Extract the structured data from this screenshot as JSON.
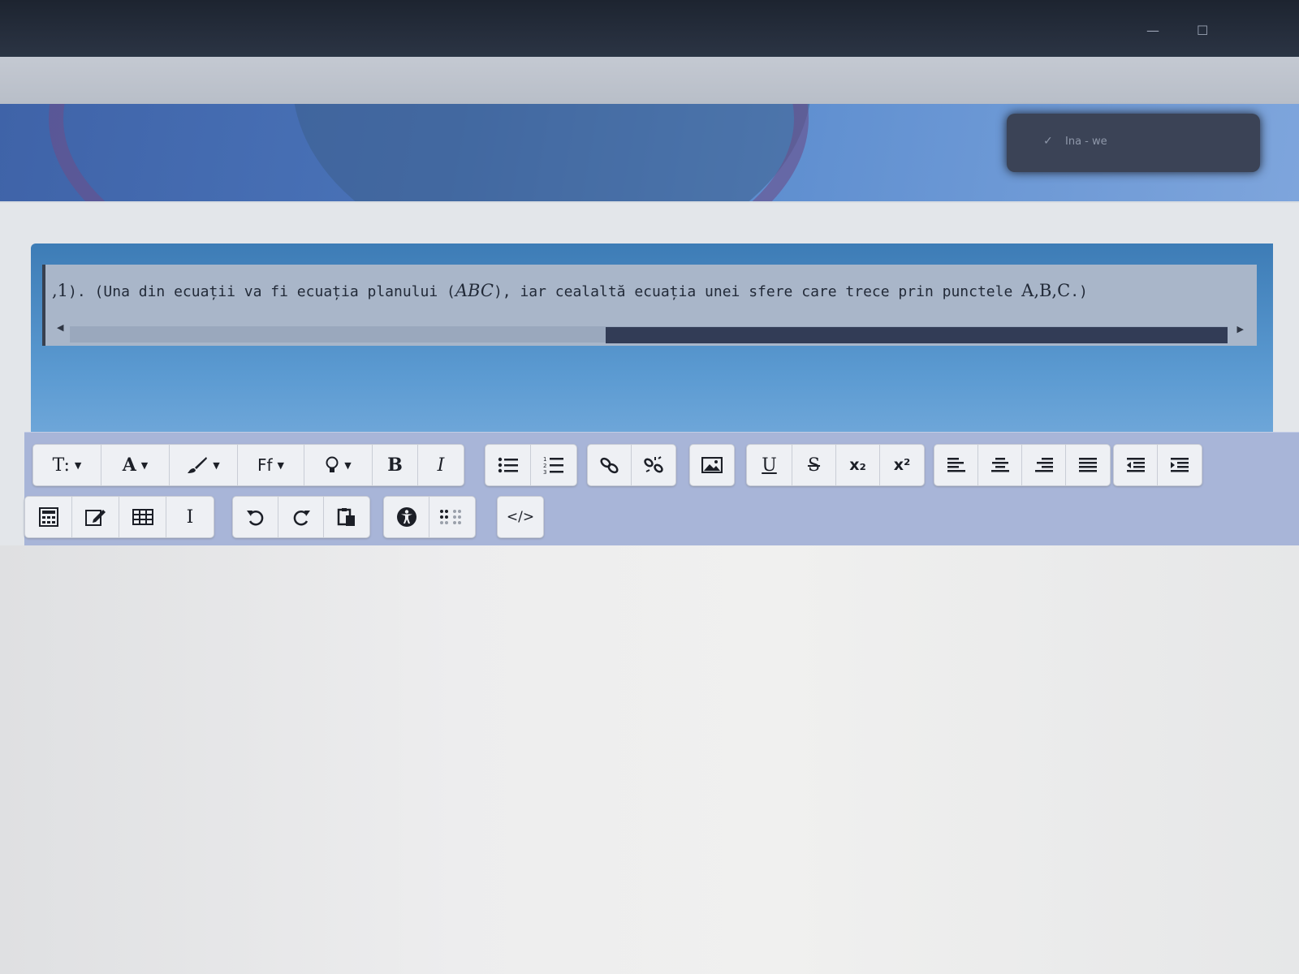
{
  "user_menu": {
    "label": "Ina - we"
  },
  "question": {
    "prefix": ",1",
    "text_1": "). (Una din ecuații va fi ecuația planului (",
    "math_abc": "ABC",
    "text_2": "), iar cealaltă ecuația unei sfere care trece prin punctele ",
    "math_points": "A,B,C",
    "text_3": ".)"
  },
  "toolbar": {
    "row1": [
      {
        "name": "paragraph-styles",
        "label": "T:"
      },
      {
        "name": "font-color",
        "label": "A"
      },
      {
        "name": "highlight-brush",
        "label": ""
      },
      {
        "name": "font-family",
        "label": "Ff"
      },
      {
        "name": "lightbulb",
        "label": ""
      },
      {
        "name": "bold",
        "label": "B"
      },
      {
        "name": "italic",
        "label": "I"
      },
      {
        "name": "bulleted-list",
        "label": ""
      },
      {
        "name": "numbered-list",
        "label": ""
      },
      {
        "name": "link",
        "label": ""
      },
      {
        "name": "unlink",
        "label": ""
      },
      {
        "name": "image",
        "label": ""
      },
      {
        "name": "underline",
        "label": "U"
      },
      {
        "name": "strikethrough",
        "label": "S"
      },
      {
        "name": "subscript",
        "label": "x₂"
      },
      {
        "name": "superscript",
        "label": "x²"
      },
      {
        "name": "align-left",
        "label": ""
      },
      {
        "name": "align-center",
        "label": ""
      },
      {
        "name": "align-right",
        "label": ""
      },
      {
        "name": "align-justify",
        "label": ""
      },
      {
        "name": "outdent",
        "label": ""
      },
      {
        "name": "indent",
        "label": ""
      }
    ],
    "row2": [
      {
        "name": "equation-editor",
        "label": ""
      },
      {
        "name": "edit",
        "label": ""
      },
      {
        "name": "table",
        "label": ""
      },
      {
        "name": "clear-formatting",
        "label": "I"
      },
      {
        "name": "undo",
        "label": ""
      },
      {
        "name": "redo",
        "label": ""
      },
      {
        "name": "paste",
        "label": ""
      },
      {
        "name": "accessibility",
        "label": ""
      },
      {
        "name": "braille",
        "label": ""
      },
      {
        "name": "html-source",
        "label": "</>"
      }
    ]
  },
  "editor": {
    "content": ""
  }
}
